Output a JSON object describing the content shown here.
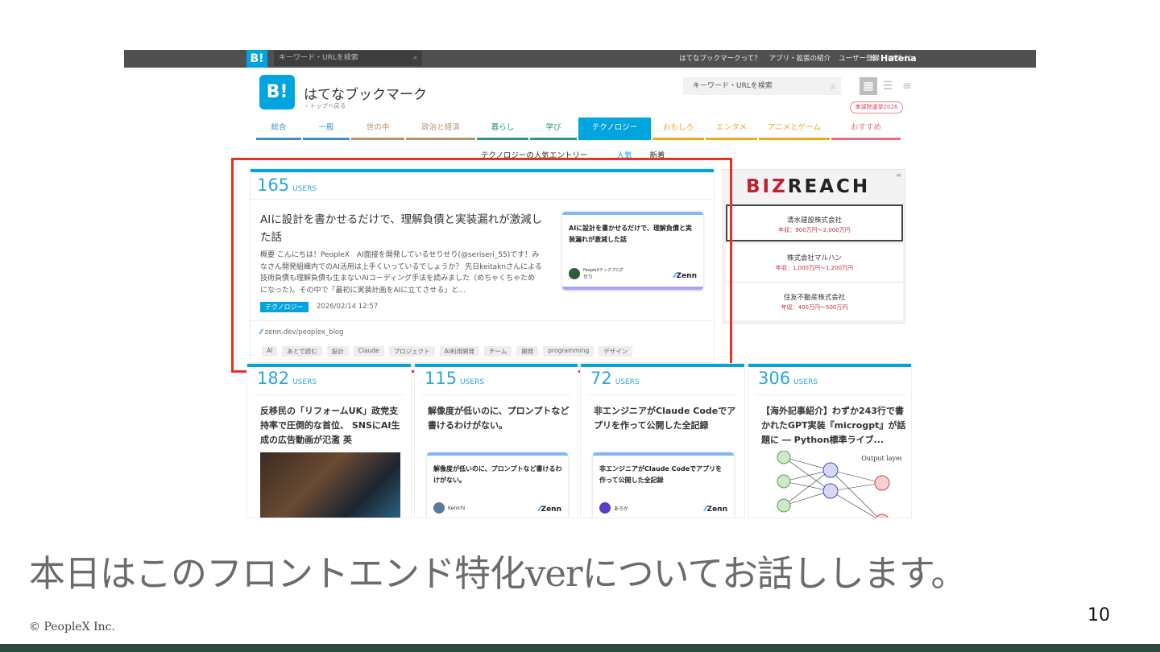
{
  "topbar": {
    "logo": "B!",
    "search_placeholder": "キーワード・URLを検索",
    "links": [
      "はてなブックマークって？",
      "アプリ・拡張の紹介",
      "ユーザー登録",
      "ログイン"
    ],
    "brand": "❊ Hatena"
  },
  "header": {
    "logo": "B!",
    "title": "はてなブックマーク",
    "back": "‹ トップへ戻る",
    "search_placeholder": "キーワード・URLを検索",
    "election_badge": "衆議院選挙2026"
  },
  "nav": [
    {
      "label": "総合",
      "color": "#3b8fd1"
    },
    {
      "label": "一般",
      "color": "#3b8fd1"
    },
    {
      "label": "世の中",
      "color": "#b8926a"
    },
    {
      "label": "政治と経済",
      "color": "#b8926a"
    },
    {
      "label": "暮らし",
      "color": "#2e9a6e"
    },
    {
      "label": "学び",
      "color": "#2e9a6e"
    },
    {
      "label": "テクノロジー",
      "color": "#00a4de",
      "active": true
    },
    {
      "label": "おもしろ",
      "color": "#e8ac1c"
    },
    {
      "label": "エンタメ",
      "color": "#e8ac1c"
    },
    {
      "label": "アニメとゲーム",
      "color": "#e8ac1c"
    },
    {
      "label": "おすすめ",
      "color": "#ec6d7f"
    }
  ],
  "subheading": {
    "title": "テクノロジーの人気エントリー",
    "popular": "人気",
    "new": "新着"
  },
  "featured": {
    "users": "165",
    "users_label": "USERS",
    "title": "AIに設計を書かせるだけで、理解負債と実装漏れが激減した話",
    "summary": "概要 こんにちは！PeopleX　AI面接を開発しているせりせり(@seriseri_55)です！みなさん開発組織内でのAI活用は上手くいっているでしょうか？ 先日keitaknさんによる技術負債も理解負債も生まないAIコーディング手法を読みました（めちゃくちゃためになった)。その中で「最初に実装計画をAIに立てさせる」と...",
    "category": "テクノロジー",
    "date": "2026/02/14 12:57",
    "source": "zenn.dev/peoplex_blog",
    "tags": [
      "AI",
      "あとで読む",
      "設計",
      "Claude",
      "プロジェクト",
      "AI利用開発",
      "チーム",
      "開発",
      "programming",
      "デザイン"
    ],
    "ogp": {
      "title": "AIに設計を書かせるだけで、理解負債と実装漏れが激減した話",
      "publication": "PeopleXテックブログ",
      "author": "せり",
      "brand": "Zenn"
    }
  },
  "ad": {
    "brand_red": "BIZ",
    "brand_black": "REACH",
    "menu": "≡",
    "jobs": [
      {
        "company": "清水建設株式会社",
        "salary": "年収：900万円〜2,000万円"
      },
      {
        "company": "株式会社マルハン",
        "salary": "年収：1,000万円〜1,200万円"
      },
      {
        "company": "住友不動産株式会社",
        "salary": "年収：400万円〜500万円"
      }
    ]
  },
  "entries": [
    {
      "users": "182",
      "title": "反移民の「リフォームUK」政党支持率で圧倒的な首位、 SNSにAI生成の広告動画が氾濫 英"
    },
    {
      "users": "115",
      "title": "解像度が低いのに、プロンプトなど書けるわけがない。",
      "ogp_title": "解像度が低いのに、プロンプトなど書けるわけがない。",
      "author": "Kenichi",
      "brand": "Zenn"
    },
    {
      "users": "72",
      "title": "非エンジニアがClaude Codeでアプリを作って公開した全記録",
      "ogp_title": "非エンジニアがClaude Codeでアプリを作って公開した全記録",
      "author": "あろか",
      "brand": "Zenn"
    },
    {
      "users": "306",
      "title": "【海外記事紹介】わずか243行で書かれたGPT実装『microgpt』が話題に ― Python標準ライブ...",
      "figure_label": "Output layer"
    }
  ],
  "users_label": "USERS",
  "slide": {
    "caption": "本日はこのフロントエンド特化verについてお話しします。",
    "copyright": "© PeopleX Inc.",
    "page": "10"
  }
}
